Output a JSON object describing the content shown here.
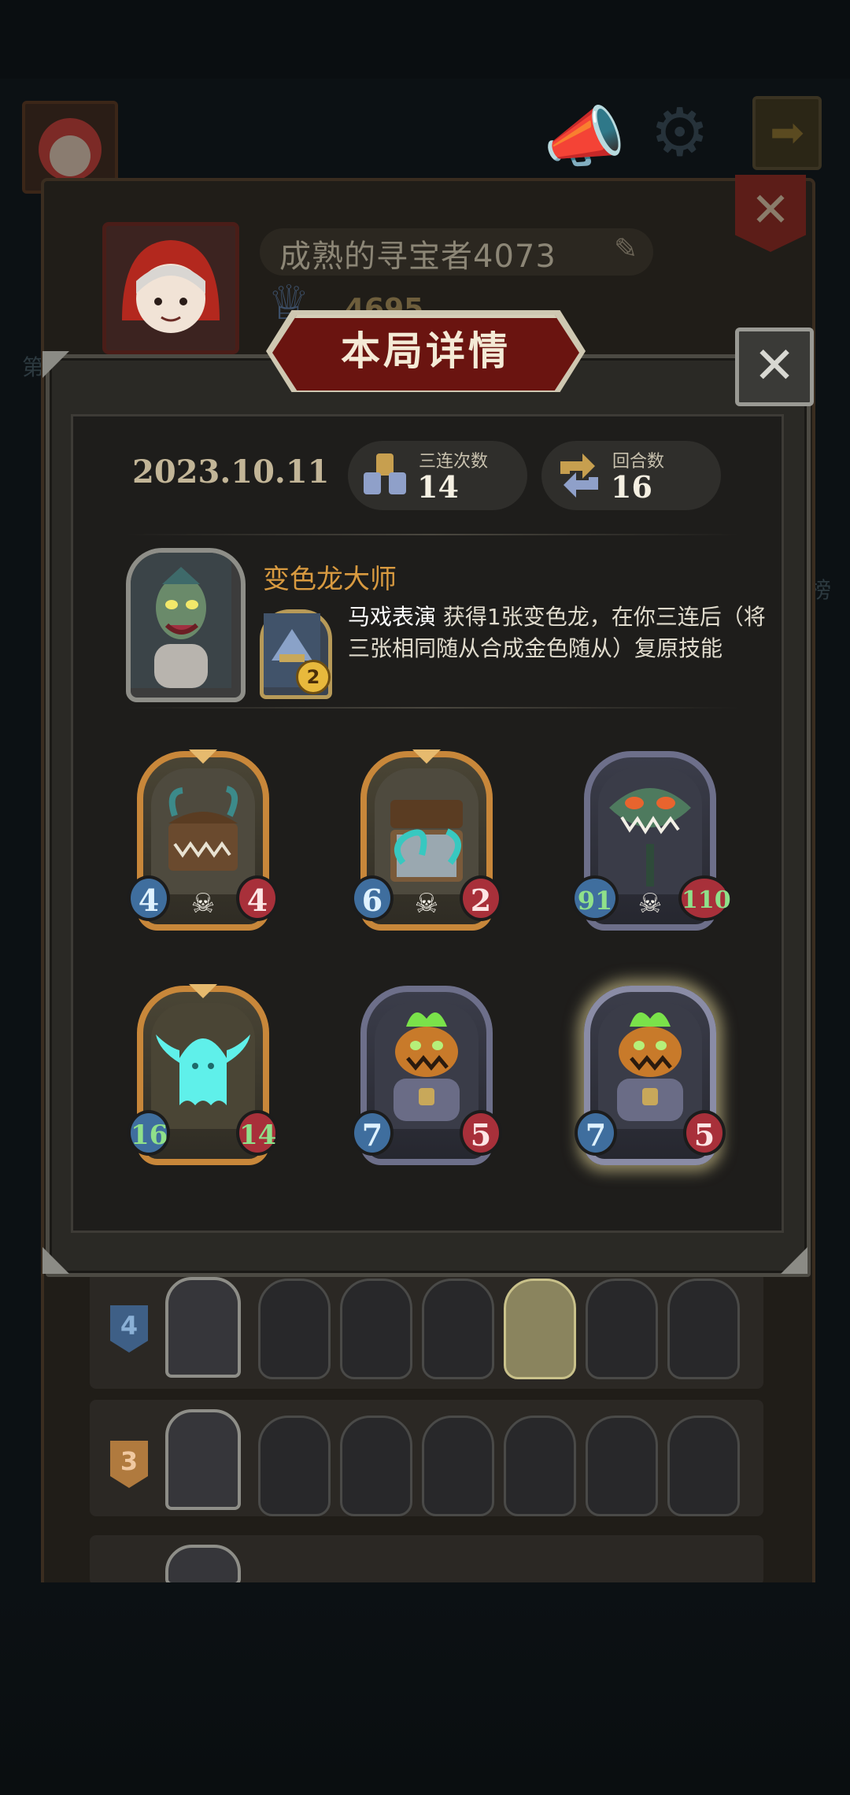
{
  "background": {
    "side_left_label": "第",
    "side_right_label": "榜"
  },
  "profile": {
    "player_name": "成熟的寻宝者4073",
    "trophy_score": "4695"
  },
  "dialog": {
    "title": "本局详情",
    "date": "2023.10.11",
    "stats": {
      "triples_label": "三连次数",
      "triples_value": "14",
      "turns_label": "回合数",
      "turns_value": "16"
    },
    "hero": {
      "name": "变色龙大师",
      "skill_level": "2",
      "skill_name": "马戏表演",
      "skill_desc": " 获得1张变色龙，在你三连后（将三张相同随从合成金色随从）复原技能"
    },
    "cards": [
      {
        "atk": "4",
        "hp": "4",
        "frame": "gold",
        "icon": "mimic-chest-icon"
      },
      {
        "atk": "6",
        "hp": "2",
        "frame": "gold",
        "icon": "treasure-chest-tentacle-icon"
      },
      {
        "atk": "91",
        "hp": "110",
        "frame": "silver",
        "icon": "grinning-plant-icon"
      },
      {
        "atk": "16",
        "hp": "14",
        "frame": "gold",
        "icon": "cyan-ghost-icon"
      },
      {
        "atk": "7",
        "hp": "5",
        "frame": "silver",
        "icon": "pumpkin-knight-icon"
      },
      {
        "atk": "7",
        "hp": "5",
        "frame": "silver-glow",
        "icon": "pumpkin-knight-icon"
      }
    ]
  },
  "history": [
    {
      "rank": "4",
      "rank_color": "#4a6a94"
    },
    {
      "rank": "3",
      "rank_color": "#b07a3e"
    },
    {
      "rank": "",
      "rank_color": "#4a6a94"
    }
  ]
}
